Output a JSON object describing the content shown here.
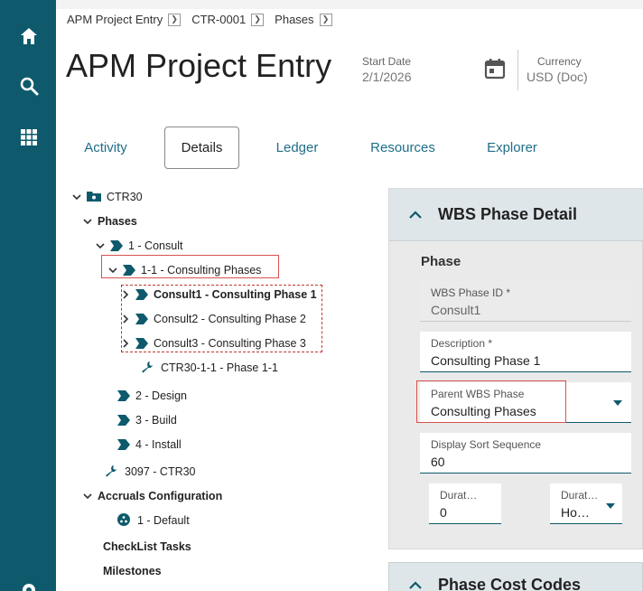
{
  "breadcrumbs": [
    "APM Project Entry",
    "CTR-0001",
    "Phases"
  ],
  "page_title": "APM Project Entry",
  "header": {
    "start_date_label": "Start Date",
    "start_date_value": "2/1/2026",
    "currency_label": "Currency",
    "currency_value": "USD (Doc)"
  },
  "tabs": [
    "Activity",
    "Details",
    "Ledger",
    "Resources",
    "Explorer"
  ],
  "active_tab": "Details",
  "tree": {
    "root": "CTR30",
    "phases": "Phases",
    "consult": "1 - Consult",
    "consulting_phases": "1-1 - Consulting Phases",
    "sub1": "Consult1 - Consulting Phase 1",
    "sub2": "Consult2 - Consulting Phase 2",
    "sub3": "Consult3 - Consulting Phase 3",
    "task": "CTR30-1-1 - Phase 1-1",
    "design": "2 - Design",
    "build": "3 - Build",
    "install": "4 - Install",
    "resource": "3097 - CTR30",
    "accruals": "Accruals Configuration",
    "default": "1 - Default",
    "checklist": "CheckList Tasks",
    "milestones": "Milestones"
  },
  "detail": {
    "title": "WBS Phase Detail",
    "section": "Phase",
    "wbs_phase_id_label": "WBS Phase ID *",
    "wbs_phase_id_value": "Consult1",
    "description_label": "Description *",
    "description_value": "Consulting Phase 1",
    "parent_label": "Parent WBS Phase",
    "parent_value": "Consulting Phases",
    "sort_label": "Display Sort Sequence",
    "sort_value": "60",
    "duration_label": "Durat…",
    "duration_value": "0",
    "duration_type_label": "Durat…",
    "duration_type_value": "Ho…"
  },
  "cost_codes_title": "Phase Cost Codes",
  "colors": {
    "rail": "#0e5a6c",
    "accent": "#1e6e87",
    "highlight": "#d9534f"
  }
}
